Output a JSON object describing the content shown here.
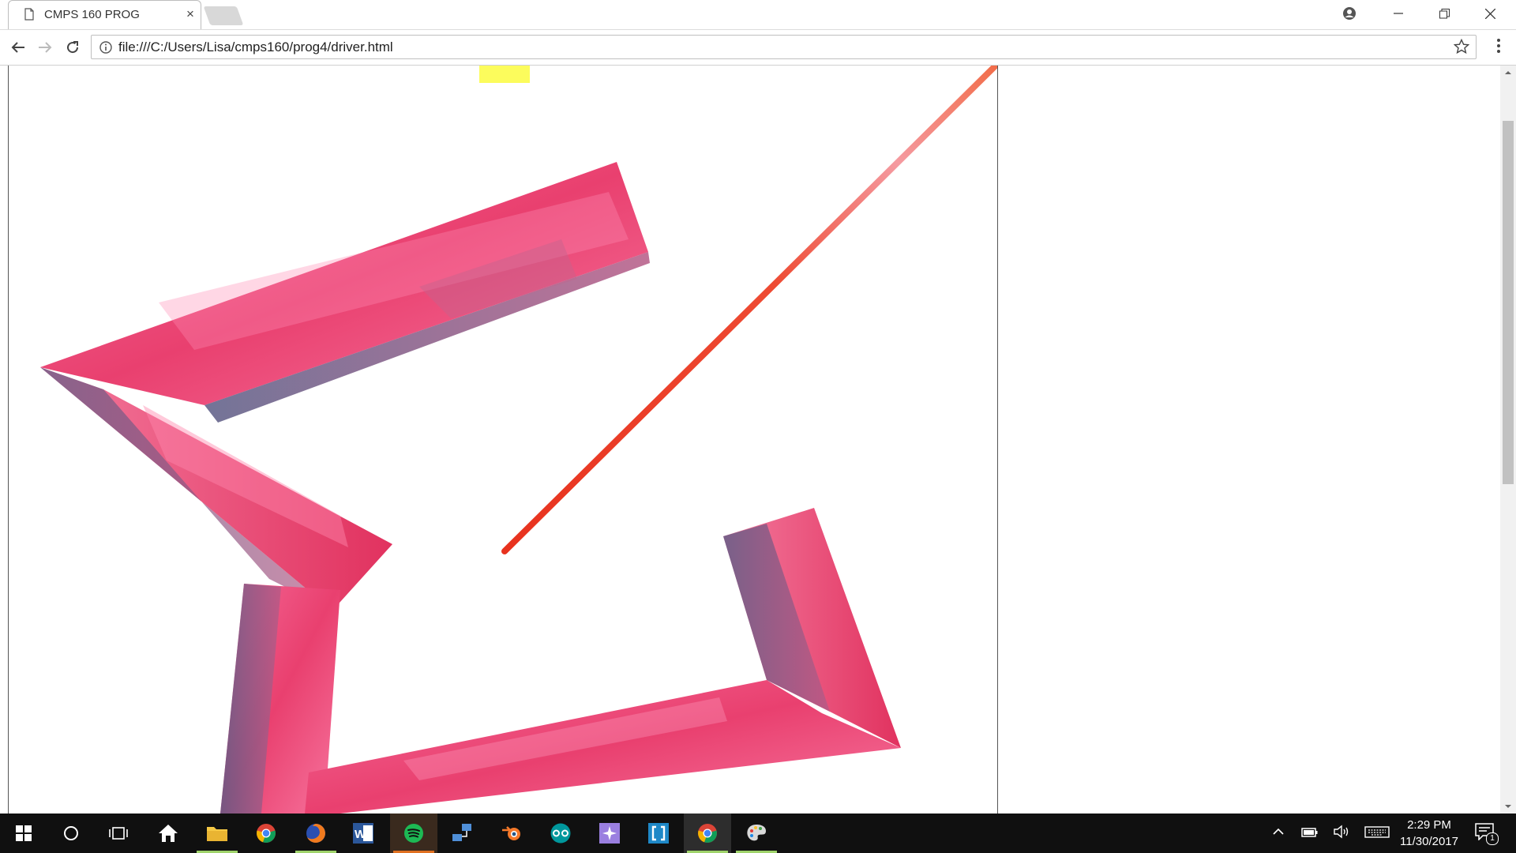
{
  "browser": {
    "tab_title": "CMPS 160 PROG",
    "tab_close": "×",
    "url": "file:///C:/Users/Lisa/cmps160/prog4/driver.html"
  },
  "taskbar": {
    "apps": [
      "start",
      "cortana",
      "task-view",
      "home",
      "file-explorer",
      "chrome",
      "firefox",
      "word",
      "spotify",
      "network",
      "blender",
      "arduino",
      "app-purple",
      "app-bracket",
      "chrome-active",
      "paint"
    ],
    "time": "2:29 PM",
    "date": "11/30/2017",
    "notification_count": "1"
  },
  "colors": {
    "accent_running": "#e07020",
    "accent_active": "#9fd36b",
    "shape_pink": "#f0517e",
    "line_red": "#e8321e",
    "highlight_yellow": "#fcfc5c"
  }
}
